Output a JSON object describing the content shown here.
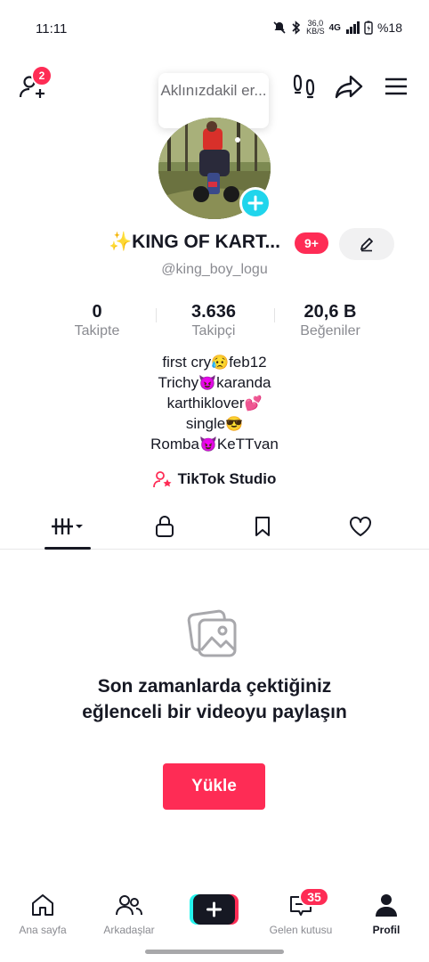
{
  "status_bar": {
    "time": "11:11",
    "speed_value": "36,0",
    "speed_unit": "KB/S",
    "network": "4G",
    "battery": "%18"
  },
  "header": {
    "friend_requests_badge": "2",
    "tooltip": "Aklınızdakil er..."
  },
  "profile": {
    "display_name": "✨KING OF KART...",
    "notification_badge": "9+",
    "username": "@king_boy_logu",
    "stats": [
      {
        "value": "0",
        "label": "Takipte"
      },
      {
        "value": "3.636",
        "label": "Takipçi"
      },
      {
        "value": "20,6 B",
        "label": "Beğeniler"
      }
    ],
    "bio_lines": [
      {
        "text": "first cry",
        "emoji": "😥",
        "rest": "feb12"
      },
      {
        "text": "Trichy",
        "emoji": "😈",
        "rest": "karanda"
      },
      {
        "text": "karthiklover",
        "emoji": "💕",
        "rest": ""
      },
      {
        "text": "single",
        "emoji": "😎",
        "rest": ""
      },
      {
        "text": "Romba",
        "emoji": "😈",
        "rest": "KeTTvan"
      }
    ],
    "studio_link": "TikTok Studio"
  },
  "tabs": [
    {
      "icon": "videos-grid-icon",
      "active": true
    },
    {
      "icon": "lock-icon",
      "active": false
    },
    {
      "icon": "bookmark-icon",
      "active": false
    },
    {
      "icon": "heart-icon",
      "active": false
    }
  ],
  "empty_state": {
    "title": "Son zamanlarda çektiğiniz eğlenceli bir videoyu paylaşın",
    "button": "Yükle"
  },
  "bottom_nav": {
    "home": "Ana sayfa",
    "friends": "Arkadaşlar",
    "inbox": "Gelen kutusu",
    "inbox_badge": "35",
    "profile": "Profil"
  },
  "colors": {
    "accent": "#fe2c55",
    "cyan": "#20d5ec",
    "text": "#161823",
    "muted": "#8a8b91"
  }
}
